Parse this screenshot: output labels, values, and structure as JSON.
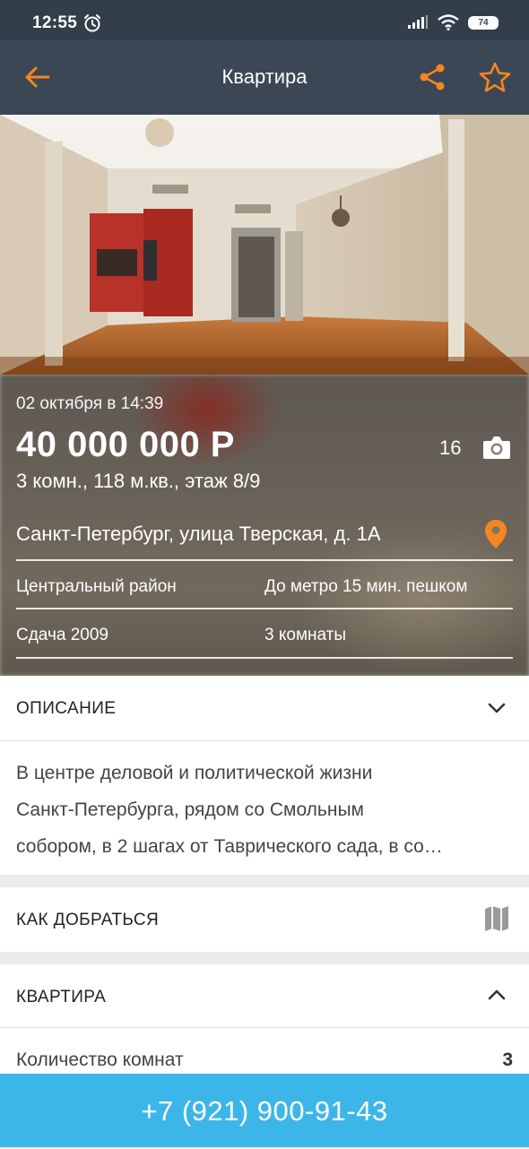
{
  "status_bar": {
    "time": "12:55",
    "battery": "74"
  },
  "app_bar": {
    "title": "Квартира"
  },
  "listing": {
    "date": "02 октября в 14:39",
    "price": "40 000 000 Р",
    "summary": "3 комн., 118 м.кв., этаж 8/9",
    "photo_count": "16",
    "address": "Санкт-Петербург, улица Тверская, д. 1А",
    "district": "Центральный район",
    "metro": "До метро 15 мин. пешком",
    "built": "Сдача 2009",
    "rooms_text": "3 комнаты"
  },
  "description": {
    "header": "ОПИСАНИЕ",
    "lines": [
      "В центре деловой и политической жизни",
      "Санкт-Петербурга, рядом со Смольным",
      "собором, в 2 шагах от Таврического сада, в со…"
    ]
  },
  "directions": {
    "header": "КАК ДОБРАТЬСЯ"
  },
  "apartment": {
    "header": "КВАРТИРА",
    "rows": [
      {
        "label": "Количество комнат",
        "value": "3"
      }
    ]
  },
  "call": {
    "phone": "+7 (921) 900-91-43"
  },
  "colors": {
    "accent": "#f5861f",
    "app_bar": "#3b4754",
    "status_bar": "#323f4b",
    "call_bar": "#3cb6e8"
  },
  "icons": [
    "alarm-icon",
    "signal-icon",
    "wifi-icon",
    "battery-icon",
    "back-arrow-icon",
    "share-icon",
    "star-icon",
    "camera-icon",
    "location-pin-icon",
    "chevron-down-icon",
    "map-icon",
    "chevron-up-icon"
  ]
}
